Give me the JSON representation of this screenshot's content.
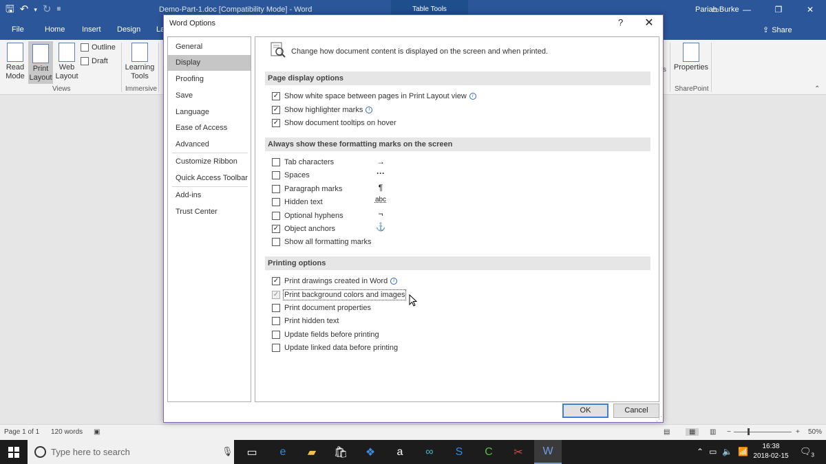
{
  "titlebar": {
    "doc_title": "Demo-Part-1.doc [Compatibility Mode]  -  Word",
    "context_tab": "Table Tools",
    "user": "Pariah Burke"
  },
  "ribbon_tabs": [
    "File",
    "Home",
    "Insert",
    "Design",
    "La"
  ],
  "share_label": "Share",
  "ribbon": {
    "read_mode": "Read Mode",
    "print_layout": "Print Layout",
    "web_layout": "Web Layout",
    "outline": "Outline",
    "draft": "Draft",
    "views_group": "Views",
    "learning_tools": "Learning Tools",
    "immersive_group": "Immersive",
    "partial_right": "s",
    "properties": "Properties",
    "sharepoint_group": "SharePoint"
  },
  "status": {
    "page": "Page 1 of 1",
    "words": "120 words",
    "zoom": "50%"
  },
  "taskbar": {
    "search_placeholder": "Type here to search",
    "time": "16:38",
    "date": "2018-02-15",
    "notifications": "3"
  },
  "dialog": {
    "title": "Word Options",
    "help": "?",
    "nav": [
      "General",
      "Display",
      "Proofing",
      "Save",
      "Language",
      "Ease of Access",
      "Advanced",
      "Customize Ribbon",
      "Quick Access Toolbar",
      "Add-ins",
      "Trust Center"
    ],
    "selected_nav": "Display",
    "header": "Change how document content is displayed on the screen and when printed.",
    "sections": {
      "page_display": {
        "title": "Page display options",
        "options": [
          {
            "label": "Show white space between pages in Print Layout view",
            "checked": true,
            "info": true
          },
          {
            "label": "Show highlighter marks",
            "checked": true,
            "info": true
          },
          {
            "label": "Show document tooltips on hover",
            "checked": true,
            "info": false
          }
        ]
      },
      "formatting_marks": {
        "title": "Always show these formatting marks on the screen",
        "options": [
          {
            "label": "Tab characters",
            "checked": false,
            "mark": "→"
          },
          {
            "label": "Spaces",
            "checked": false,
            "mark": "···"
          },
          {
            "label": "Paragraph marks",
            "checked": false,
            "mark": "¶"
          },
          {
            "label": "Hidden text",
            "checked": false,
            "mark": "abc"
          },
          {
            "label": "Optional hyphens",
            "checked": false,
            "mark": "¬"
          },
          {
            "label": "Object anchors",
            "checked": true,
            "mark": "⚓"
          },
          {
            "label": "Show all formatting marks",
            "checked": false,
            "mark": ""
          }
        ]
      },
      "printing": {
        "title": "Printing options",
        "options": [
          {
            "label": "Print drawings created in Word",
            "checked": true,
            "info": true
          },
          {
            "label": "Print background colors and images",
            "checked": true,
            "info": false
          },
          {
            "label": "Print document properties",
            "checked": false,
            "info": false
          },
          {
            "label": "Print hidden text",
            "checked": false,
            "info": false
          },
          {
            "label": "Update fields before printing",
            "checked": false,
            "info": false
          },
          {
            "label": "Update linked data before printing",
            "checked": false,
            "info": false
          }
        ]
      }
    },
    "ok_label": "OK",
    "cancel_label": "Cancel"
  },
  "colors": {
    "word_blue": "#2b579a",
    "dialog_border": "#8a5fb8",
    "ok_focus": "#3c7fd6"
  }
}
